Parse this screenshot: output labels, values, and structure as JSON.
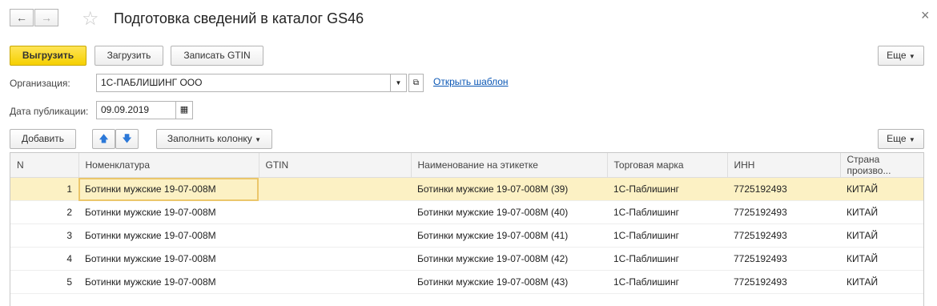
{
  "header": {
    "title": "Подготовка сведений в каталог GS46",
    "back_glyph": "←",
    "forward_glyph": "→",
    "star_glyph": "☆",
    "close_glyph": "×"
  },
  "toolbar": {
    "upload_label": "Выгрузить",
    "load_label": "Загрузить",
    "write_gtin_label": "Записать GTIN",
    "more_label": "Еще"
  },
  "form": {
    "organization_label": "Организация:",
    "organization_value": "1С-ПАБЛИШИНГ ООО",
    "open_template_link": "Открыть шаблон",
    "pub_date_label": "Дата публикации:",
    "pub_date_value": "09.09.2019"
  },
  "table_toolbar": {
    "add_label": "Добавить",
    "fill_column_label": "Заполнить колонку",
    "more_label": "Еще"
  },
  "table": {
    "columns": [
      "N",
      "Номенклатура",
      "GTIN",
      "Наименование на этикетке",
      "Торговая марка",
      "ИНН",
      "Страна произво..."
    ],
    "rows": [
      {
        "n": "1",
        "nom": "Ботинки мужские 19-07-008М",
        "gtin": "",
        "name": "Ботинки мужские 19-07-008М (39)",
        "brand": "1С-Паблишинг",
        "inn": "7725192493",
        "country": "КИТАЙ"
      },
      {
        "n": "2",
        "nom": "Ботинки мужские 19-07-008М",
        "gtin": "",
        "name": "Ботинки мужские 19-07-008М (40)",
        "brand": "1С-Паблишинг",
        "inn": "7725192493",
        "country": "КИТАЙ"
      },
      {
        "n": "3",
        "nom": "Ботинки мужские 19-07-008М",
        "gtin": "",
        "name": "Ботинки мужские 19-07-008М (41)",
        "brand": "1С-Паблишинг",
        "inn": "7725192493",
        "country": "КИТАЙ"
      },
      {
        "n": "4",
        "nom": "Ботинки мужские 19-07-008М",
        "gtin": "",
        "name": "Ботинки мужские 19-07-008М (42)",
        "brand": "1С-Паблишинг",
        "inn": "7725192493",
        "country": "КИТАЙ"
      },
      {
        "n": "5",
        "nom": "Ботинки мужские 19-07-008М",
        "gtin": "",
        "name": "Ботинки мужские 19-07-008М (43)",
        "brand": "1С-Паблишинг",
        "inn": "7725192493",
        "country": "КИТАЙ"
      }
    ]
  }
}
